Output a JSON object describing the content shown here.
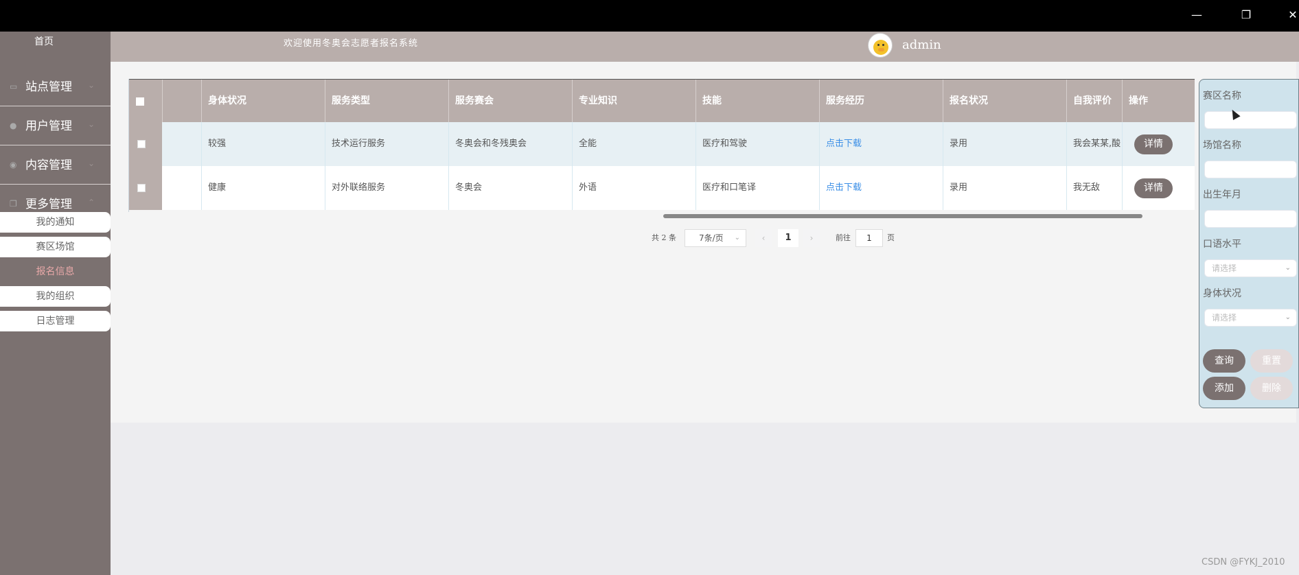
{
  "window": {
    "minimize": "—",
    "restore": "❐",
    "close": "✕"
  },
  "sidebar": {
    "home": "首页",
    "menus": [
      {
        "label": "站点管理",
        "icon": "monitor-icon"
      },
      {
        "label": "用户管理",
        "icon": "user-icon"
      },
      {
        "label": "内容管理",
        "icon": "eye-icon"
      },
      {
        "label": "更多管理",
        "icon": "copy-icon"
      }
    ],
    "submenu": [
      "我的通知",
      "赛区场馆",
      "报名信息",
      "我的组织",
      "日志管理"
    ],
    "active_submenu": "报名信息"
  },
  "header": {
    "welcome": "欢迎使用冬奥会志愿者报名系统",
    "username": "admin"
  },
  "table": {
    "columns": [
      "身体状况",
      "服务类型",
      "服务赛会",
      "专业知识",
      "技能",
      "服务经历",
      "报名状况",
      "自我评价",
      "操作"
    ],
    "rows": [
      {
        "身体状况": "较强",
        "服务类型": "技术运行服务",
        "服务赛会": "冬奥会和冬残奥会",
        "专业知识": "全能",
        "技能": "医疗和驾驶",
        "服务经历": "点击下载",
        "报名状况": "录用",
        "自我评价": "我会某某,酸",
        "操作": "详情"
      },
      {
        "身体状况": "健康",
        "服务类型": "对外联络服务",
        "服务赛会": "冬奥会",
        "专业知识": "外语",
        "技能": "医疗和口笔译",
        "服务经历": "点击下载",
        "报名状况": "录用",
        "自我评价": "我无敌",
        "操作": "详情"
      }
    ]
  },
  "pagination": {
    "total": "共 2 条",
    "page_size": "7条/页",
    "current": "1",
    "goto_label": "前往",
    "goto_value": "1",
    "unit": "页",
    "prev": "‹",
    "next": "›"
  },
  "filter": {
    "fields": [
      {
        "label": "赛区名称",
        "type": "input"
      },
      {
        "label": "场馆名称",
        "type": "input"
      },
      {
        "label": "出生年月",
        "type": "input"
      },
      {
        "label": "口语水平",
        "type": "select",
        "placeholder": "请选择"
      },
      {
        "label": "身体状况",
        "type": "select",
        "placeholder": "请选择"
      }
    ],
    "buttons": {
      "query": "查询",
      "reset": "重置",
      "add": "添加",
      "delete": "删除"
    }
  },
  "watermark": "CSDN @FYKJ_2010"
}
